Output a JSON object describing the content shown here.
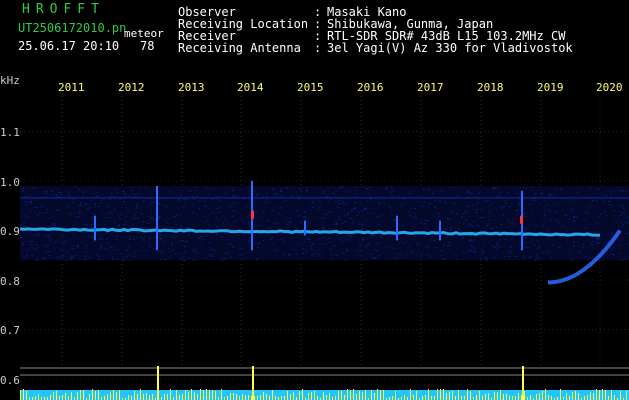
{
  "header": {
    "brand": "HROFFT",
    "filename": "UT2506172010.pn",
    "meteor_label": "meteor",
    "date_time": "25.06.17 20:10",
    "count": "78"
  },
  "observation": {
    "labels": [
      "Observer",
      "Receiving Location",
      "Receiver",
      "Receiving Antenna"
    ],
    "separators": [
      ":",
      ":",
      ":",
      ":"
    ],
    "values": [
      "Masaki Kano",
      "Shibukawa, Gunma, Japan",
      "RTL-SDR SDR# 43dB L15 103.2MHz CW",
      "3el Yagi(V) Az 330 for Vladivostok"
    ]
  },
  "chart_data": {
    "type": "heatmap",
    "y_unit": "kHz",
    "y_ticks": [
      "1.1",
      "1.0",
      "0.9",
      "0.8",
      "0.7",
      "0.6"
    ],
    "x_ticks": [
      "2011",
      "2012",
      "2013",
      "2014",
      "2015",
      "2016",
      "2017",
      "2018",
      "2019",
      "2020"
    ],
    "grid": true,
    "colors": {
      "background": "#000000",
      "signal": "#2a6cff",
      "carrier": "#2ab8ff",
      "meteor_hot": "#ff3344",
      "count_bars": "#ffff44",
      "count_base": "#22c6ff"
    }
  }
}
